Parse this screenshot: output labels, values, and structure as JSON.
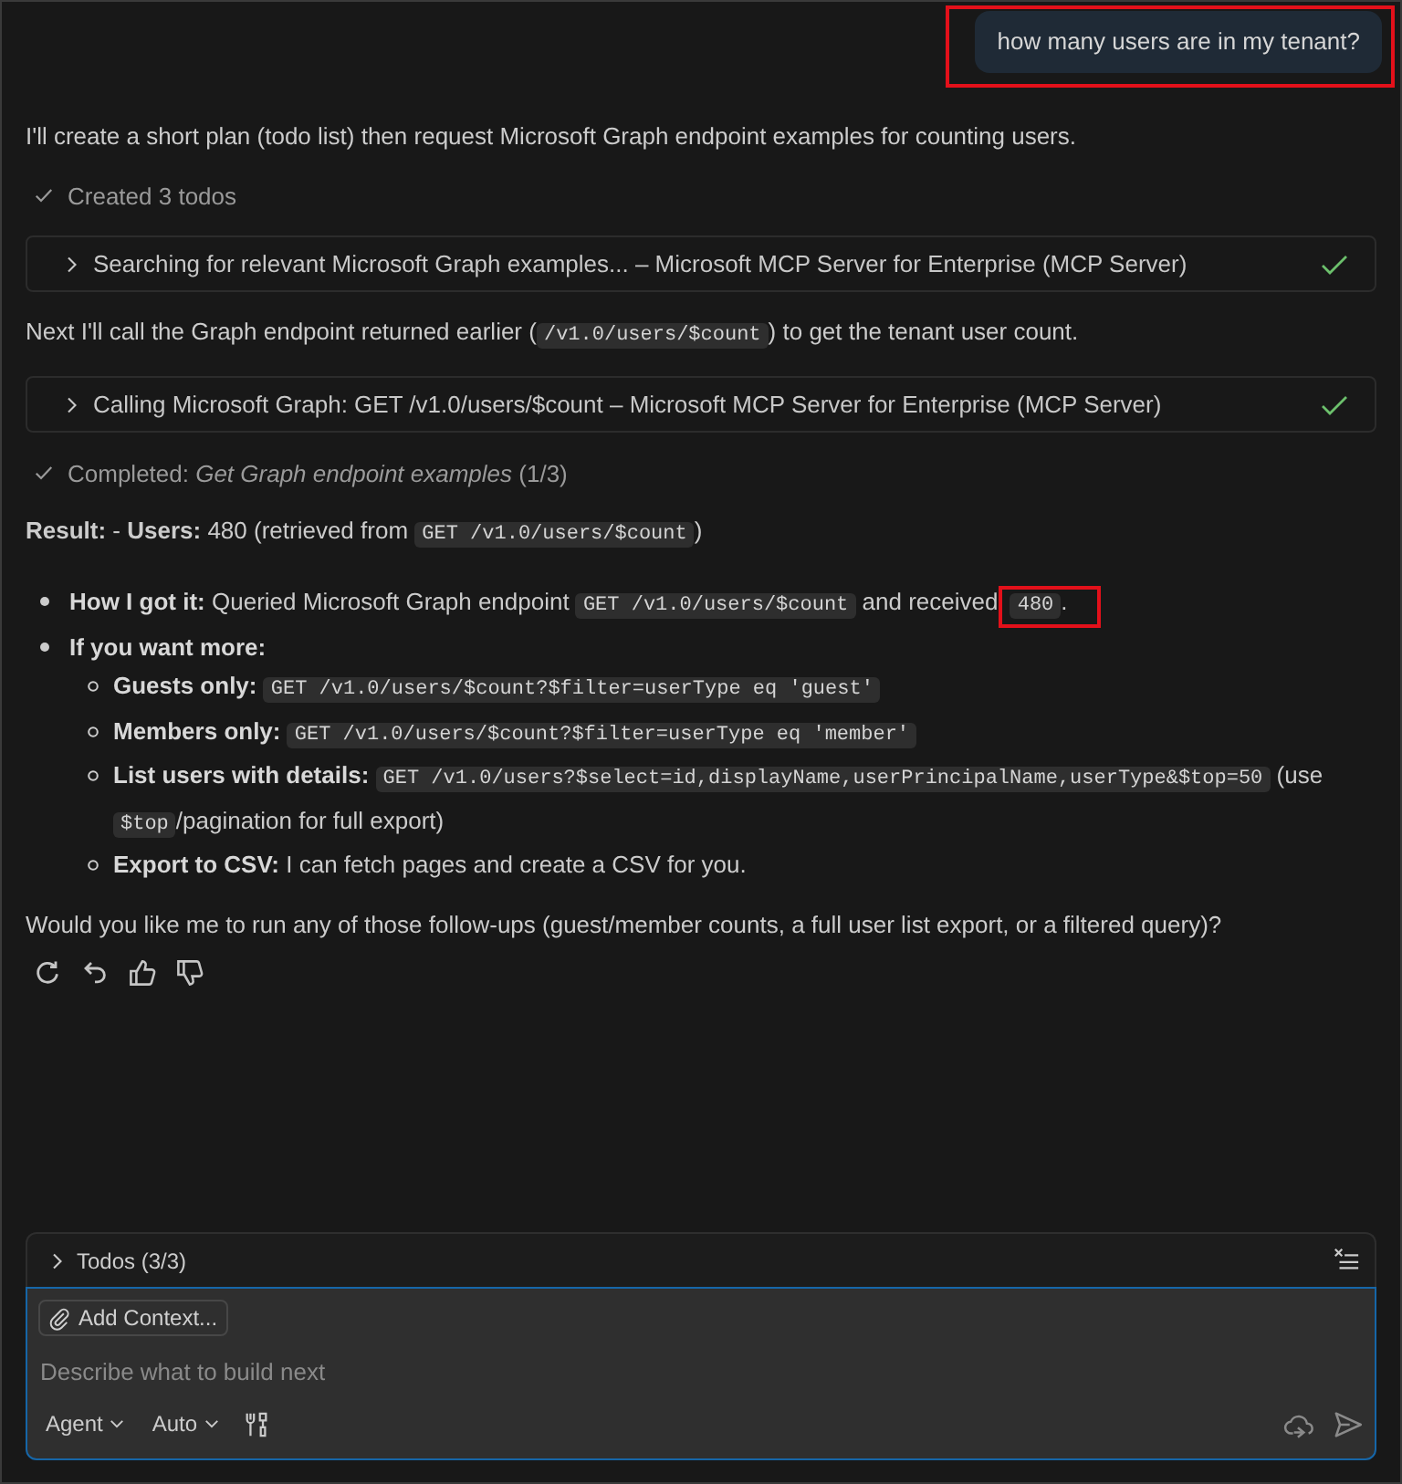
{
  "user_message": {
    "text": "how many users are in my tenant?",
    "highlighted": true
  },
  "response": [
    {
      "kind": "paragraph",
      "parts": [
        {
          "kind": "text",
          "text": "I'll create a short plan (todo list) then request Microsoft Graph endpoint examples for counting users."
        }
      ]
    },
    {
      "kind": "status",
      "text": "Created 3 todos",
      "done": true
    },
    {
      "kind": "tool_call",
      "text": "Searching for relevant Microsoft Graph examples... – Microsoft MCP Server for Enterprise (MCP Server)",
      "expanded": false,
      "done": true
    },
    {
      "kind": "paragraph",
      "parts": [
        {
          "kind": "text",
          "text": "Next I'll call the Graph endpoint returned earlier ("
        },
        {
          "kind": "code",
          "text": "/v1.0/users/$count"
        },
        {
          "kind": "text",
          "text": ") to get the tenant user count."
        }
      ]
    },
    {
      "kind": "tool_call",
      "text": "Calling Microsoft Graph: GET /v1.0/users/$count – Microsoft MCP Server for Enterprise (MCP Server)",
      "expanded": false,
      "done": true
    },
    {
      "kind": "status",
      "text": "Completed: *Get Graph endpoint examples* (1/3)",
      "done": true
    },
    {
      "kind": "paragraph",
      "parts": [
        {
          "kind": "text",
          "text": "**Result:** - **Users:** 480 (retrieved from "
        },
        {
          "kind": "code",
          "text": "GET /v1.0/users/$count"
        },
        {
          "kind": "text",
          "text": ")"
        }
      ]
    },
    {
      "kind": "list",
      "items": [
        {
          "label": "How I got it:",
          "parts": [
            {
              "kind": "text",
              "text": "Queried Microsoft Graph endpoint "
            },
            {
              "kind": "code",
              "text": "GET /v1.0/users/$count"
            },
            {
              "kind": "text",
              "text": " and received "
            },
            {
              "kind": "marked",
              "text": "480"
            },
            {
              "kind": "text",
              "text": "."
            }
          ]
        },
        {
          "label": "If you want more:",
          "children": [
            {
              "label": "Guests only:",
              "parts": [
                {
                  "kind": "code",
                  "text": "GET /v1.0/users/$count?$filter=userType eq 'guest'"
                }
              ]
            },
            {
              "label": "Members only:",
              "parts": [
                {
                  "kind": "code",
                  "text": "GET /v1.0/users/$count?$filter=userType eq 'member'"
                }
              ]
            },
            {
              "label": "List users with details:",
              "parts": [
                {
                  "kind": "code",
                  "text": "GET /v1.0/users?$select=id,displayName,userPrincipalName,userType&$top=50"
                },
                {
                  "kind": "text",
                  "text": " (use "
                },
                {
                  "kind": "code",
                  "text": "$top"
                },
                {
                  "kind": "text",
                  "text": "/pagination for full export)"
                }
              ]
            },
            {
              "label": "Export to CSV:",
              "parts": [
                {
                  "kind": "text",
                  "text": "I can fetch pages and create a CSV for you."
                }
              ]
            }
          ]
        }
      ]
    },
    {
      "kind": "paragraph",
      "parts": [
        {
          "kind": "text",
          "text": "Would you like me to run any of those follow-ups (guest/member counts, a full user list export, or a filtered query)?"
        }
      ]
    }
  ],
  "todos": {
    "label": "Todos (3/3)",
    "expanded": false
  },
  "composer": {
    "context_button": "Add Context...",
    "placeholder": "Describe what to build next",
    "mode": "Agent",
    "model": "Auto"
  }
}
